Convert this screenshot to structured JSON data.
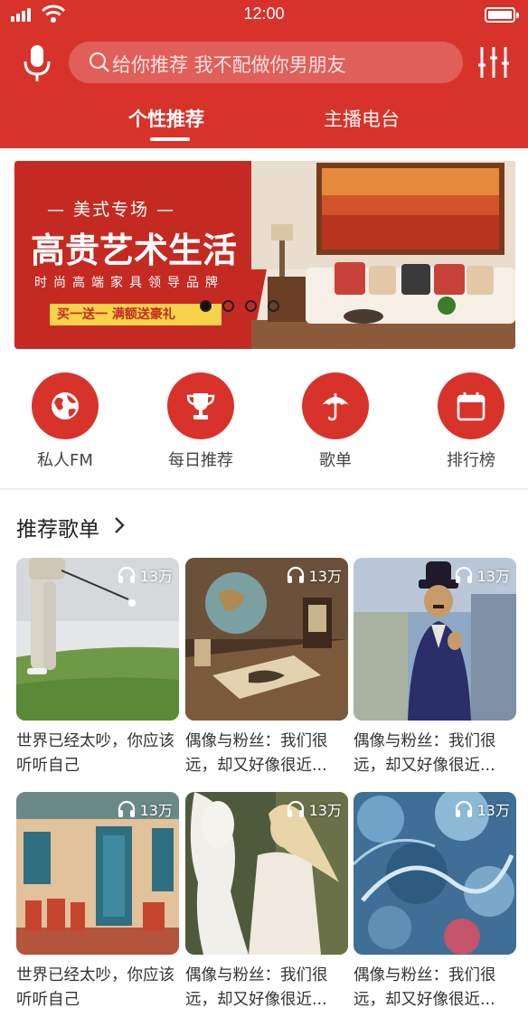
{
  "status_bar": {
    "time": "12:00"
  },
  "search": {
    "placeholder": "给你推荐 我不配做你男朋友"
  },
  "tabs": [
    {
      "label": "个性推荐",
      "active": true
    },
    {
      "label": "主播电台",
      "active": false
    }
  ],
  "banner": {
    "tag": "— 美式专场 —",
    "title": "高贵艺术生活",
    "subtitle": "时尚高端家具领导品牌",
    "promo": "买一送一  满额送豪礼",
    "active_slide": 1,
    "slide_count": 4
  },
  "quick_nav": [
    {
      "label": "私人FM",
      "icon": "globe-icon"
    },
    {
      "label": "每日推荐",
      "icon": "trophy-icon"
    },
    {
      "label": "歌单",
      "icon": "umbrella-icon"
    },
    {
      "label": "排行榜",
      "icon": "calendar-icon"
    }
  ],
  "section": {
    "title": "推荐歌单"
  },
  "playlists": [
    {
      "title": "世界已经太吵，你应该听听自己",
      "plays": "13万",
      "cover": "golf"
    },
    {
      "title": "偶像与粉丝：我们很远，却又好像很近...",
      "plays": "13万",
      "cover": "desk"
    },
    {
      "title": "偶像与粉丝：我们很远，却又好像很近...",
      "plays": "13万",
      "cover": "figure"
    },
    {
      "title": "世界已经太吵，你应该听听自己",
      "plays": "13万",
      "cover": "cafe"
    },
    {
      "title": "偶像与粉丝：我们很远，却又好像很近...",
      "plays": "13万",
      "cover": "horse"
    },
    {
      "title": "偶像与粉丝：我们很远，却又好像很近...",
      "plays": "13万",
      "cover": "abstract"
    }
  ],
  "colors": {
    "brand": "#d8332b",
    "promo": "#f6d34a"
  }
}
